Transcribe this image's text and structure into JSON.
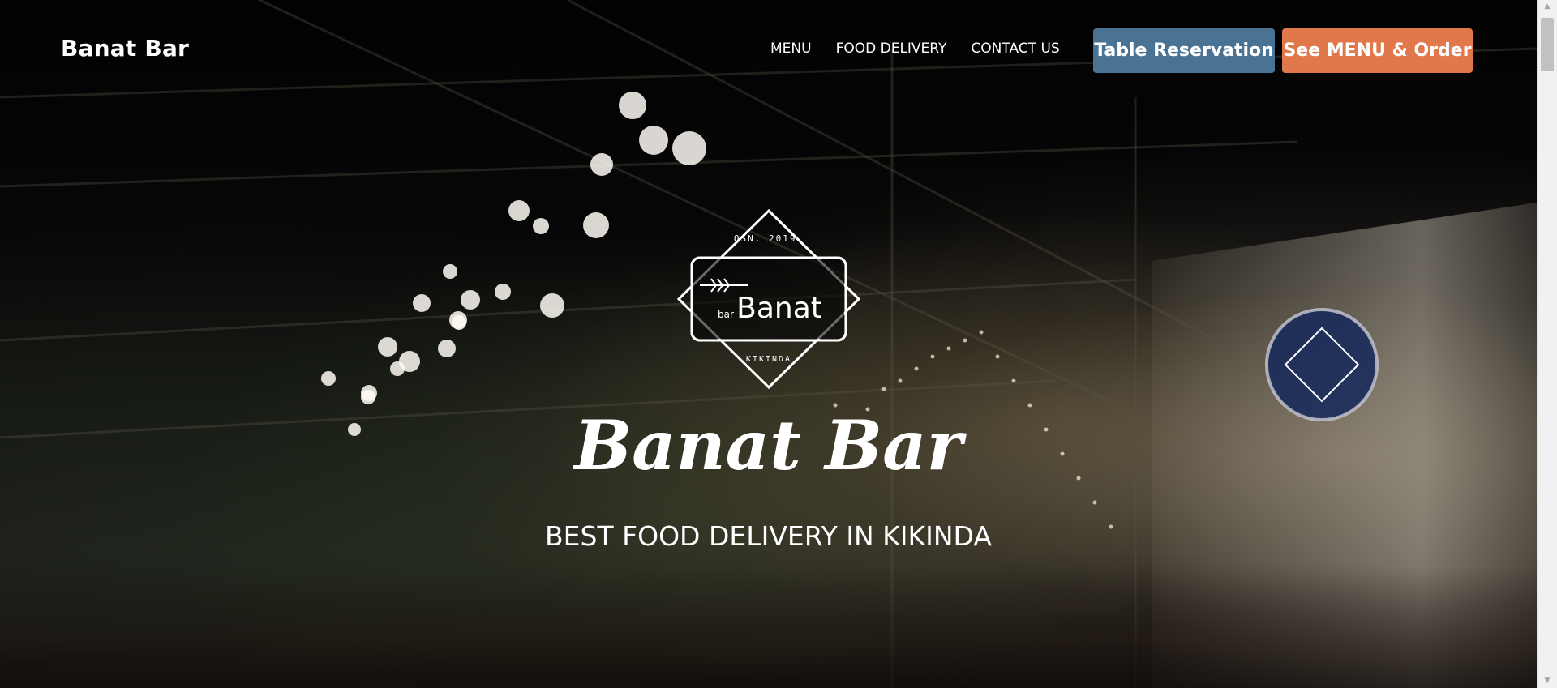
{
  "header": {
    "brand": "Banat Bar",
    "nav": [
      {
        "label": "MENU"
      },
      {
        "label": "FOOD DELIVERY"
      },
      {
        "label": "CONTACT US"
      }
    ],
    "reserve_button": "Table Reservation",
    "order_button": "See MENU & Order"
  },
  "hero": {
    "logo": {
      "top_text": "OSN. 2019.",
      "small_text": "bar",
      "main_text": "Banat",
      "bottom_text": "KIKINDA"
    },
    "title": "Banat Bar",
    "subtitle": "BEST FOOD DELIVERY IN KIKINDA"
  },
  "colors": {
    "reserve_button": "#4a7393",
    "order_button": "#e0784b",
    "text": "#ffffff"
  },
  "icons": {
    "scroll_up": "arrow-up-icon",
    "scroll_down": "arrow-down-icon"
  }
}
